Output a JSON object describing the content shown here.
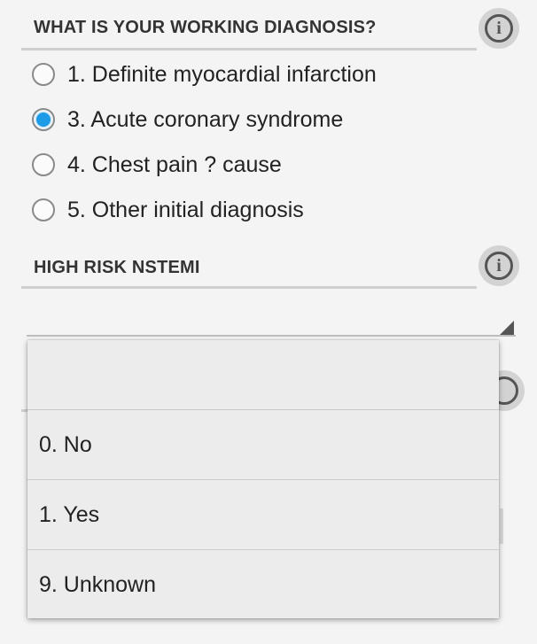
{
  "sections": {
    "diagnosis": {
      "title": "WHAT IS YOUR WORKING DIAGNOSIS?",
      "info_label": "i"
    },
    "nstemi": {
      "title": "HIGH RISK NSTEMI",
      "info_label": "i"
    }
  },
  "diagnosis_options": [
    {
      "label": "1. Definite myocardial infarction",
      "checked": false
    },
    {
      "label": "3. Acute coronary syndrome",
      "checked": true
    },
    {
      "label": "4. Chest pain ? cause",
      "checked": false
    },
    {
      "label": "5. Other initial diagnosis",
      "checked": false
    }
  ],
  "nstemi_spinner": {
    "selected": ""
  },
  "dropdown": {
    "items": [
      {
        "label": ""
      },
      {
        "label": "0. No"
      },
      {
        "label": "1. Yes"
      },
      {
        "label": "9. Unknown"
      }
    ]
  },
  "colors": {
    "accent": "#1e9be6",
    "background": "#f4f4f4",
    "rule": "#cfcfcf"
  },
  "icons": {
    "info": "info-icon",
    "spinner": "dropdown-triangle-icon"
  }
}
